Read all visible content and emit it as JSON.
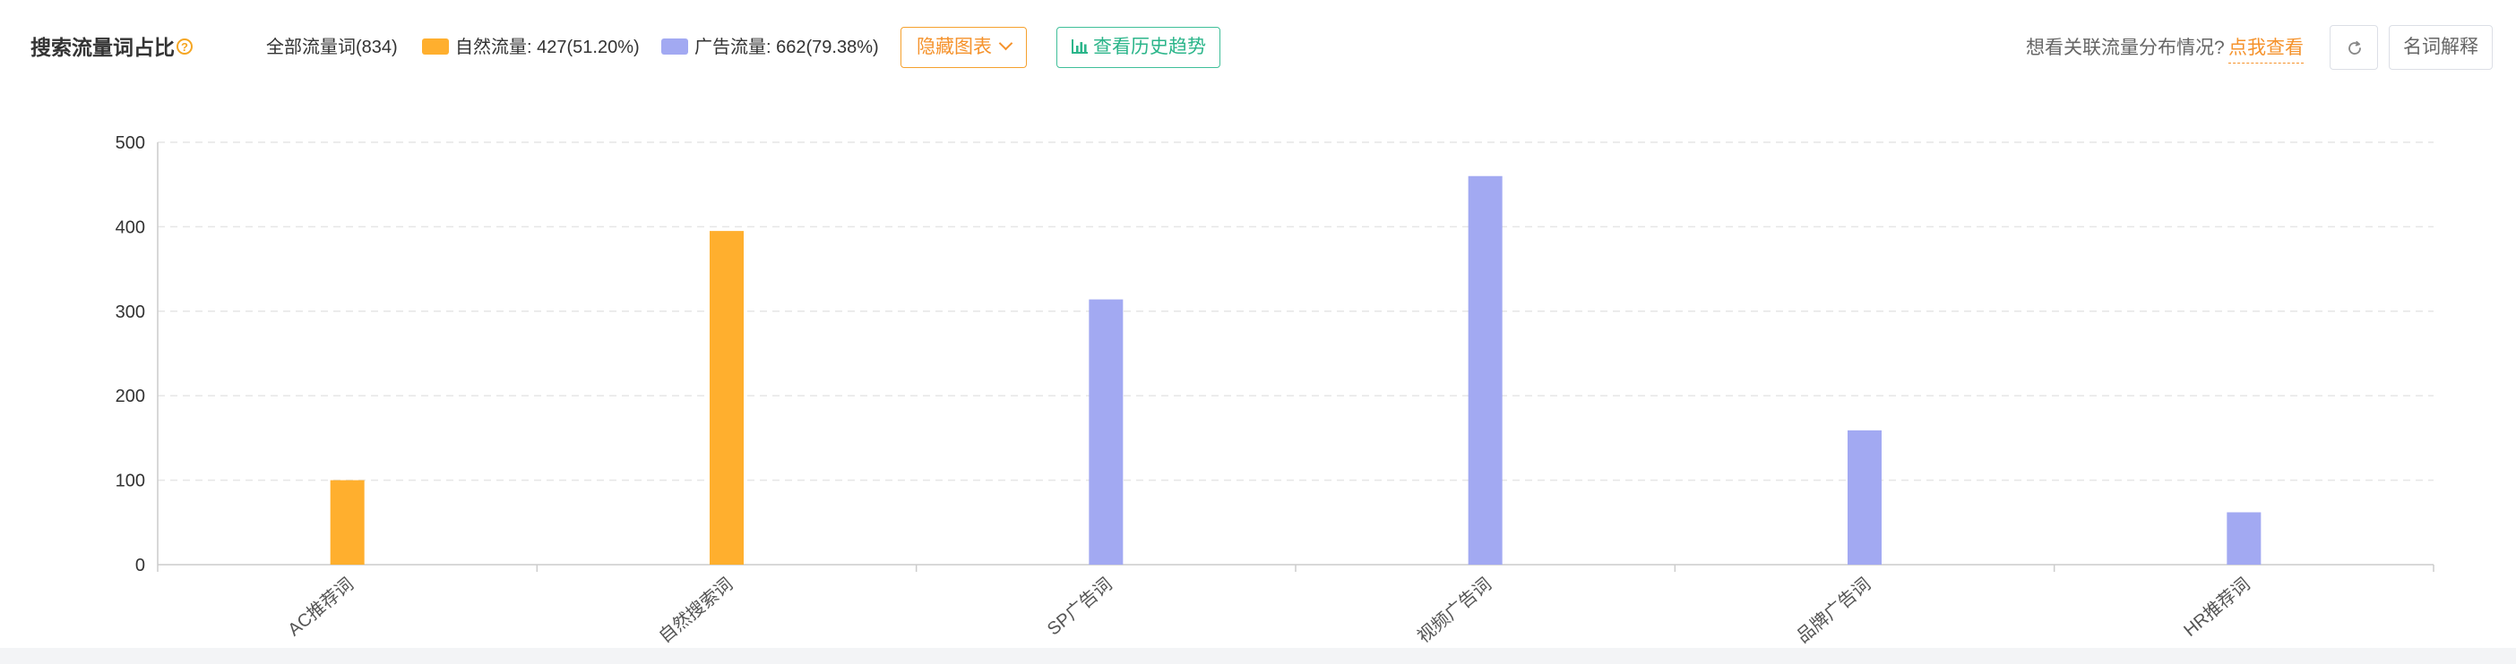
{
  "header": {
    "title": "搜索流量词占比",
    "help_icon_glyph": "?",
    "legend_total": "全部流量词(834)",
    "legend_natural": "自然流量: 427(51.20%)",
    "legend_ad": "广告流量: 662(79.38%)",
    "hide_chart_label": "隐藏图表",
    "history_trend_label": "查看历史趋势",
    "hint_text": "想看关联流量分布情况?",
    "hint_link": "点我查看",
    "glossary_label": "名词解释"
  },
  "icons": {
    "help": "question-circle-icon",
    "hide_chart": "chevron-down-icon",
    "history": "bar-chart-icon",
    "refresh": "refresh-icon"
  },
  "colors": {
    "natural": "#FFAF2E",
    "ad": "#A2A9F2",
    "accent_orange": "#F5922B",
    "accent_green": "#2BB58A",
    "grid": "#E6E6E6",
    "axis": "#CCCCCC",
    "tick_text": "#333333",
    "category_text": "#555555"
  },
  "chart_data": {
    "type": "bar",
    "categories": [
      "AC推荐词",
      "自然搜索词",
      "SP广告词",
      "视频广告词",
      "品牌广告词",
      "HR推荐词"
    ],
    "values": [
      100,
      395,
      314,
      460,
      159,
      62
    ],
    "bar_colors": [
      "#FFAF2E",
      "#FFAF2E",
      "#A2A9F2",
      "#A2A9F2",
      "#A2A9F2",
      "#A2A9F2"
    ],
    "ylim": [
      0,
      500
    ],
    "yticks": [
      0,
      100,
      200,
      300,
      400,
      500
    ],
    "grid": true,
    "gridline_style": "dashed"
  }
}
